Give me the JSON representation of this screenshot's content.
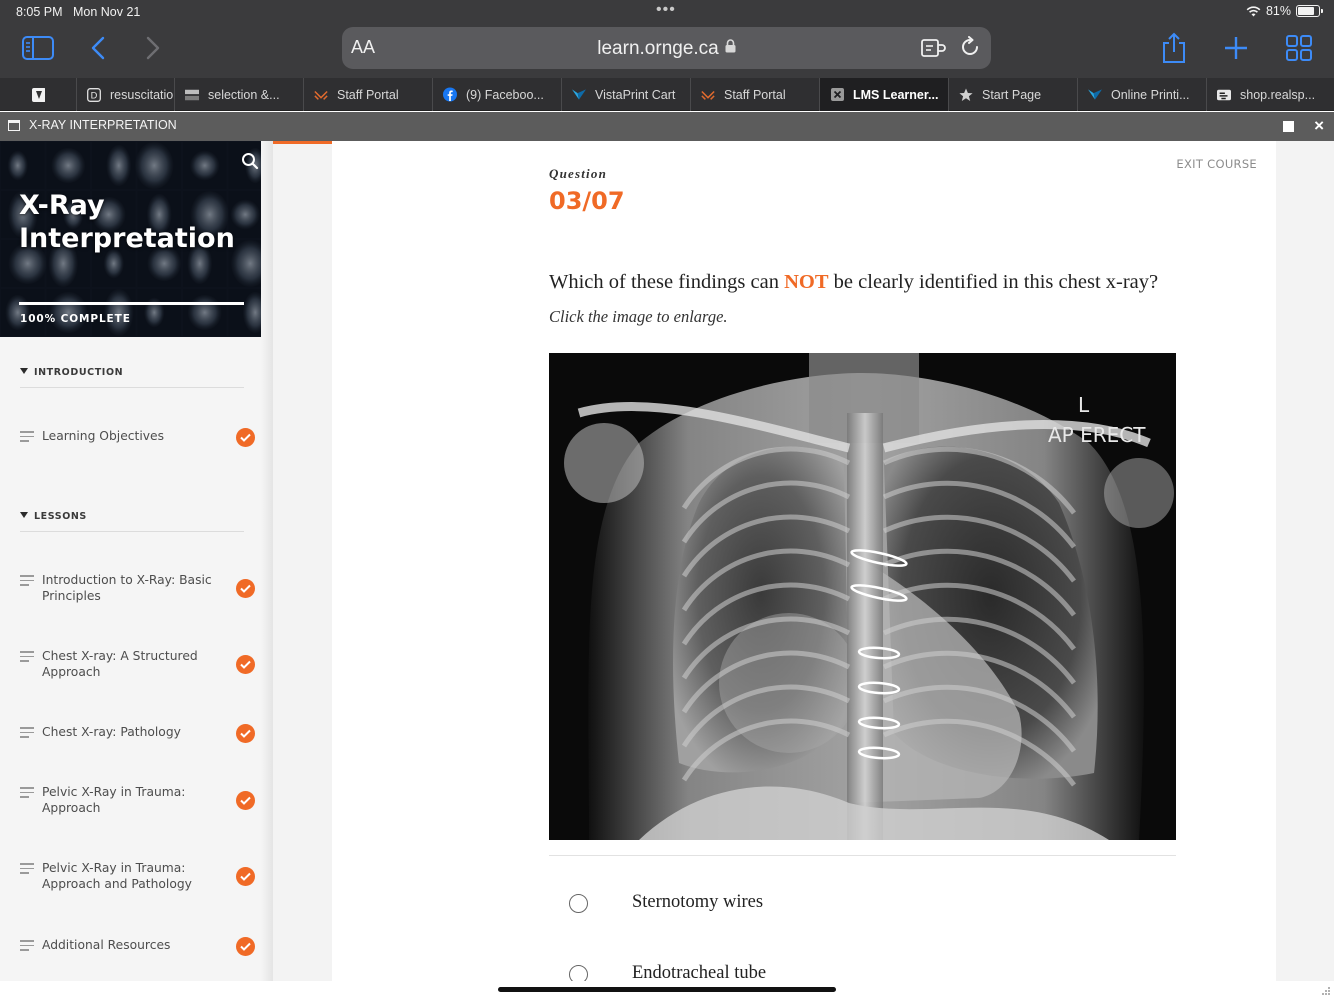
{
  "status_bar": {
    "time": "8:05 PM",
    "date": "Mon Nov 21",
    "battery_percent": "81%",
    "battery_level": 0.81,
    "icons": [
      "wifi-icon",
      "battery-icon"
    ]
  },
  "browser": {
    "text_size_button": "AA",
    "url": "learn.ornge.ca",
    "accent_color": "#3d8bf7",
    "toolbar_icons": [
      "sidebar-icon",
      "back-icon",
      "forward-icon",
      "share-icon",
      "new-tab-icon",
      "tab-overview-icon"
    ]
  },
  "tabs": [
    {
      "label": "resuscitatio",
      "favicon": "document-icon"
    },
    {
      "label": "selection &...",
      "favicon": "image-icon"
    },
    {
      "label": "Staff Portal",
      "favicon": "ornge-icon"
    },
    {
      "label": "(9) Faceboo...",
      "favicon": "facebook-icon"
    },
    {
      "label": "VistaPrint Cart",
      "favicon": "vistaprint-icon"
    },
    {
      "label": "Staff Portal",
      "favicon": "ornge-icon"
    },
    {
      "label": "LMS Learner...",
      "favicon": "lms-icon",
      "active": true
    },
    {
      "label": "Start Page",
      "favicon": "star-icon"
    },
    {
      "label": "Online Printi...",
      "favicon": "vistaprint-icon"
    },
    {
      "label": "shop.realsp...",
      "favicon": "shop-icon"
    }
  ],
  "course_bar": {
    "title": "X-RAY INTERPRETATION"
  },
  "sidebar": {
    "course_title": "X-Ray Interpretation",
    "progress_label": "100% COMPLETE",
    "progress": 1.0,
    "sections": [
      {
        "heading": "INTRODUCTION",
        "items": [
          {
            "label": "Learning Objectives",
            "completed": true
          }
        ]
      },
      {
        "heading": "LESSONS",
        "items": [
          {
            "label": "Introduction to X-Ray: Basic Principles",
            "completed": true
          },
          {
            "label": "Chest X-ray: A Structured Approach",
            "completed": true
          },
          {
            "label": "Chest X-ray: Pathology",
            "completed": true
          },
          {
            "label": "Pelvic X-Ray in Trauma: Approach",
            "completed": true
          },
          {
            "label": "Pelvic X-Ray in Trauma: Approach and Pathology",
            "completed": true
          },
          {
            "label": "Additional Resources",
            "completed": true
          }
        ]
      }
    ]
  },
  "main": {
    "exit_label": "EXIT COURSE",
    "question_label": "Question",
    "question_number": "03/07",
    "question_text_before": "Which of these findings can ",
    "question_text_emphasis": "NOT",
    "question_text_after": " be clearly identified in this chest x-ray?",
    "instruction": "Click the image to enlarge.",
    "image": {
      "side_marker": "L",
      "projection": "AP ERECT"
    },
    "answers": [
      {
        "label": "Sternotomy wires"
      },
      {
        "label": "Endotracheal tube"
      }
    ],
    "accent_color": "#f06a26"
  }
}
